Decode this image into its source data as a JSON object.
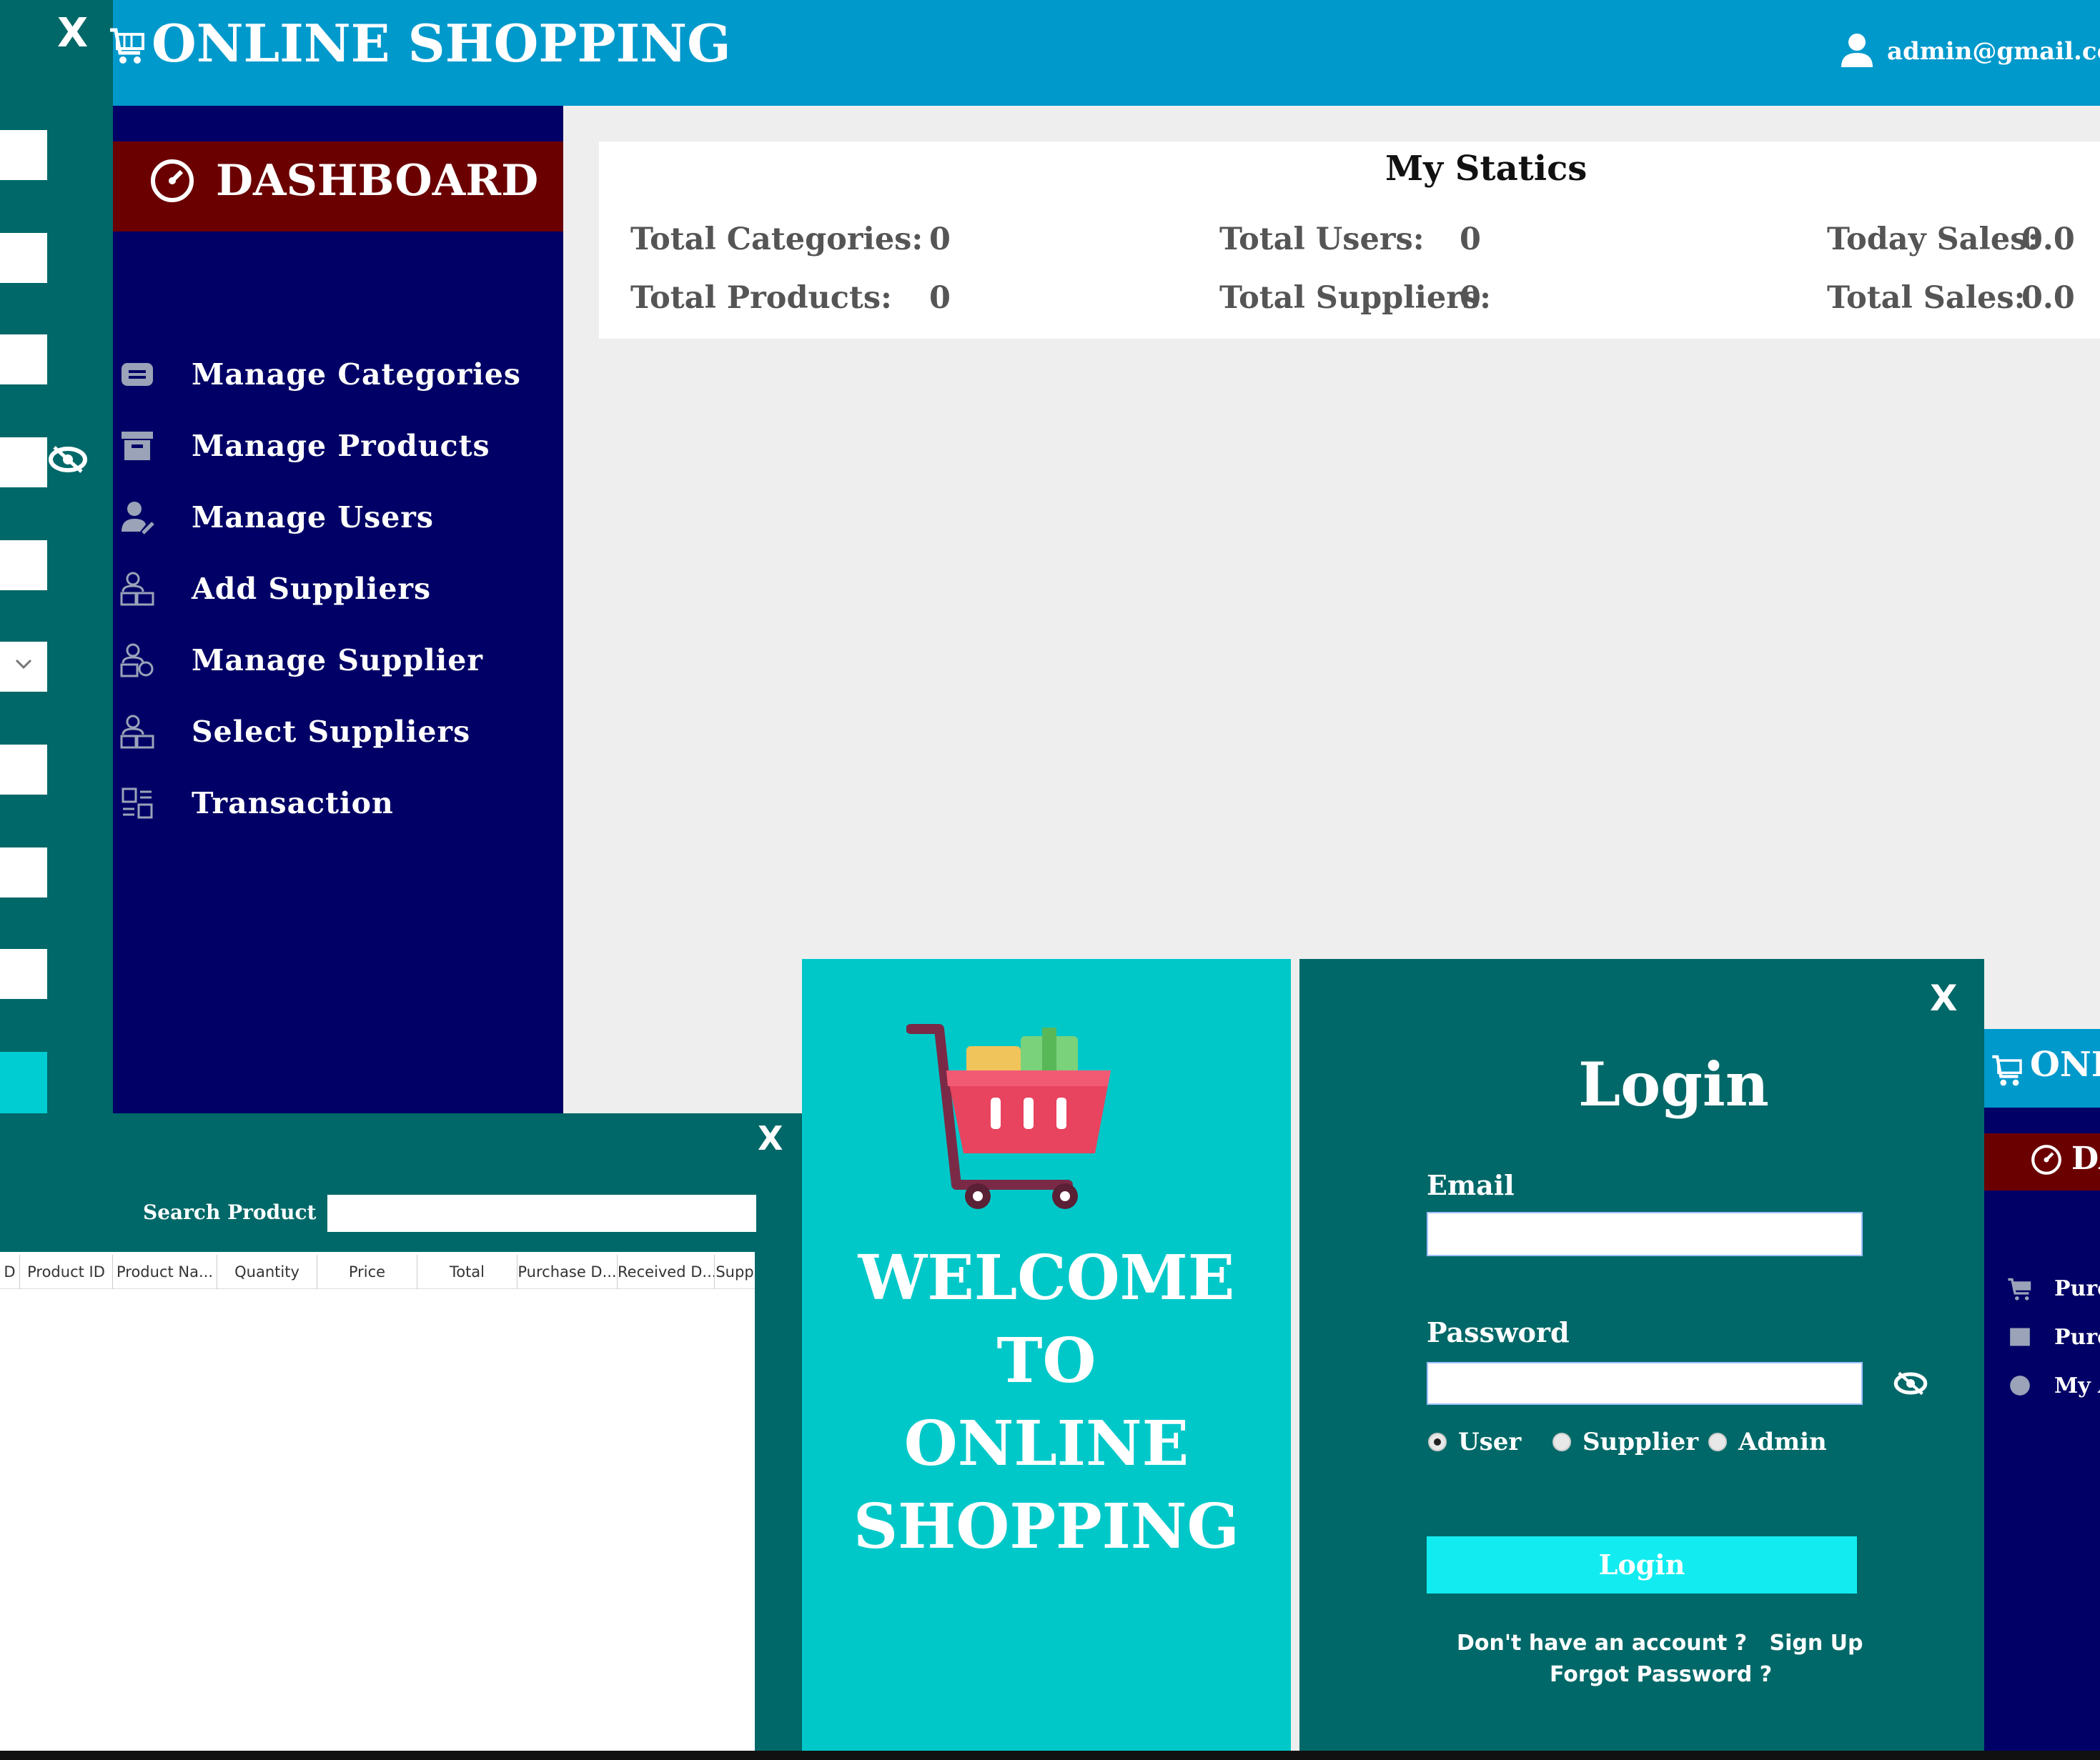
{
  "main_window": {
    "title": "ONLINE SHOPPING",
    "user_email": "admin@gmail.com",
    "dashboard_label": "DASHBOARD",
    "nav": [
      {
        "label": "Manage Categories",
        "icon": "categories-icon"
      },
      {
        "label": "Manage Products",
        "icon": "archive-box-icon"
      },
      {
        "label": "Manage Users",
        "icon": "user-edit-icon"
      },
      {
        "label": "Add Suppliers",
        "icon": "supplier-add-icon"
      },
      {
        "label": "Manage Supplier",
        "icon": "supplier-manage-icon"
      },
      {
        "label": "Select Suppliers",
        "icon": "supplier-select-icon"
      },
      {
        "label": "Transaction",
        "icon": "transaction-icon"
      }
    ],
    "stats": {
      "title": "My Statics",
      "total_categories_label": "Total Categories:",
      "total_categories_value": "0",
      "total_products_label": "Total Products:",
      "total_products_value": "0",
      "total_users_label": "Total Users:",
      "total_users_value": "0",
      "total_suppliers_label": "Total Suppliers:",
      "total_suppliers_value": "0",
      "today_sales_label": "Today Sales:",
      "today_sales_value": "0.0",
      "total_sales_label": "Total Sales:",
      "total_sales_value": "0.0"
    }
  },
  "left_window": {
    "close_label": "X"
  },
  "purchase_window": {
    "close_label": "X",
    "search_label": "Search Product",
    "search_value": "",
    "columns": [
      "D",
      "Product ID",
      "Product Na...",
      "Quantity",
      "Price",
      "Total",
      "Purchase D...",
      "Received D...",
      "Supp"
    ]
  },
  "welcome": {
    "lines": [
      "WELCOME",
      "TO",
      "ONLINE",
      "SHOPPING"
    ]
  },
  "login": {
    "close_label": "X",
    "title": "Login",
    "email_label": "Email",
    "email_value": "",
    "password_label": "Password",
    "password_value": "",
    "roles": [
      {
        "label": "User",
        "selected": true
      },
      {
        "label": "Supplier",
        "selected": false
      },
      {
        "label": "Admin",
        "selected": false
      }
    ],
    "button_label": "Login",
    "signup_prompt": "Don't have an account ?",
    "signup_link": "Sign Up",
    "forgot_link": "Forgot Password ?"
  },
  "right_window": {
    "title": "ONL",
    "dashboard_label": "DA",
    "items": [
      "Purc",
      "Purc",
      "My A"
    ]
  },
  "colors": {
    "topbar": "#0099cc",
    "sidebar": "#010066",
    "dashboard_banner": "#6b0000",
    "teal_dark": "#006868",
    "teal_light": "#00c8c9",
    "login_button": "#12ecf0"
  }
}
